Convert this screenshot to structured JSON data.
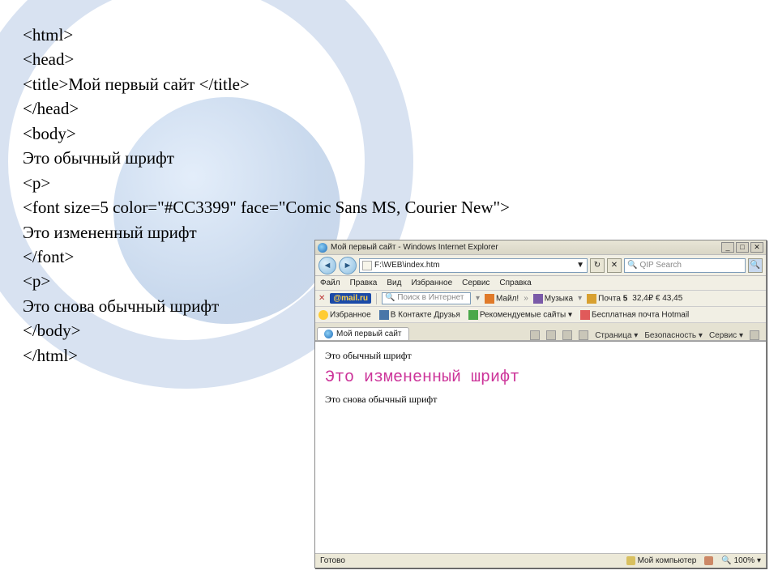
{
  "code": {
    "l1": "<html>",
    "l2": "<head>",
    "l3a": "<title>",
    "l3b": "Мой первый сайт ",
    "l3c": "</title>",
    "l4": "</head>",
    "l5": "<body>",
    "l6": "Это обычный шрифт",
    "l7": "<p>",
    "l8": "<font size=5 color=\"#CC3399\" face=\"Comic Sans MS, Courier New\">",
    "l9": "Это измененный шрифт",
    "l10": "</font>",
    "l11": "<p>",
    "l12": "Это снова обычный шрифт",
    "l13": "</body>",
    "l14": "</html>"
  },
  "ie": {
    "title": "Мой первый сайт - Windows Internet Explorer",
    "address": "F:\\WEB\\index.htm",
    "search_placeholder": "QIP Search",
    "menu": [
      "Файл",
      "Правка",
      "Вид",
      "Избранное",
      "Сервис",
      "Справка"
    ],
    "mailru_label": "@mail.ru",
    "mailru_search": "Поиск в Интернет",
    "tb": {
      "mail": "Майл!",
      "music": "Музыка",
      "post_label": "Почта",
      "post_count": "5",
      "sum1": "32,4₽",
      "sum2": "€",
      "sum3": "43,45"
    },
    "fav": {
      "favorites": "Избранное",
      "vk": "В Контакте  Друзья",
      "rec": "Рекомендуемые сайты",
      "free": "Бесплатная почта Hotmail"
    },
    "tab_label": "Мой первый сайт",
    "tools": {
      "page": "Страница",
      "security": "Безопасность",
      "service": "Сервис"
    },
    "content": {
      "p1": "Это обычный шрифт",
      "p2": "Это измененный шрифт",
      "p3": "Это снова обычный шрифт"
    },
    "status": {
      "done": "Готово",
      "zone": "Мой компьютер",
      "zoom": "100%"
    }
  }
}
